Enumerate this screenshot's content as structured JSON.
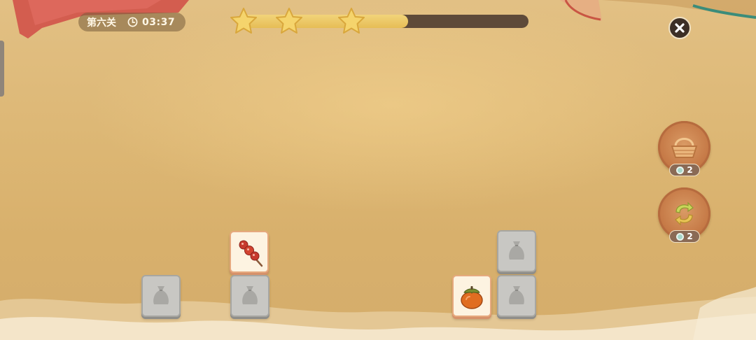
{
  "hud": {
    "level_label": "第六关",
    "timer": "03:37",
    "clock_icon": "clock-icon",
    "progress_fraction": 0.58,
    "stars_earned": 3,
    "close_icon": "close-icon"
  },
  "powerups": [
    {
      "icon": "basket-icon",
      "count": "2"
    },
    {
      "icon": "shuffle-icon",
      "count": "2"
    }
  ],
  "tiles": [
    {
      "item": "candied-hawthorn-icon",
      "state": "open"
    },
    {
      "item": "persimmon-icon",
      "state": "open"
    },
    {
      "item": "sack-icon",
      "state": "locked"
    },
    {
      "item": "sack-icon",
      "state": "locked"
    },
    {
      "item": "sack-icon",
      "state": "locked"
    },
    {
      "item": "sack-icon",
      "state": "locked"
    }
  ],
  "colors": {
    "background": "#dcb673",
    "progress_fill": "#e6bd55",
    "progress_track": "#5e4a39",
    "powerup": "#c67a47"
  }
}
